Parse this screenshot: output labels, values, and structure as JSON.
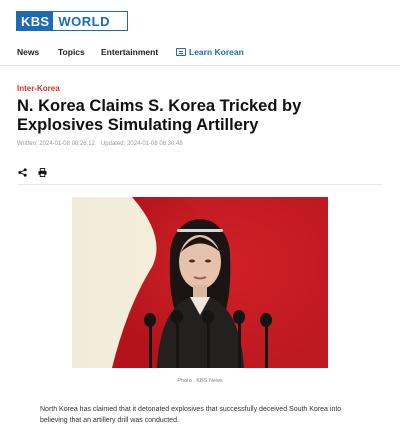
{
  "brand": {
    "logo_kbs": "KBS",
    "logo_world": "WORLD"
  },
  "nav": {
    "items": [
      {
        "label": "News"
      },
      {
        "label": "Topics"
      },
      {
        "label": "Entertainment"
      },
      {
        "label": "Learn Korean",
        "icon": "book-icon"
      }
    ]
  },
  "article": {
    "category": "Inter-Korea",
    "title": "N. Korea Claims S. Korea Tricked by Explosives Simulating Artillery",
    "written": "Written: 2024-01-08 08:26:12",
    "updated": "Updated: 2024-01-08 08:30:48",
    "tools": [
      {
        "icon": "share-icon"
      },
      {
        "icon": "print-icon"
      }
    ],
    "photo_caption": "Photo : KBS News",
    "body": "North Korea has claimed that it detonated explosives that successfully deceived South Korea into believing that an artillery drill was conducted."
  },
  "colors": {
    "brand_blue": "#1c6bb3",
    "category_red": "#d4332e"
  }
}
